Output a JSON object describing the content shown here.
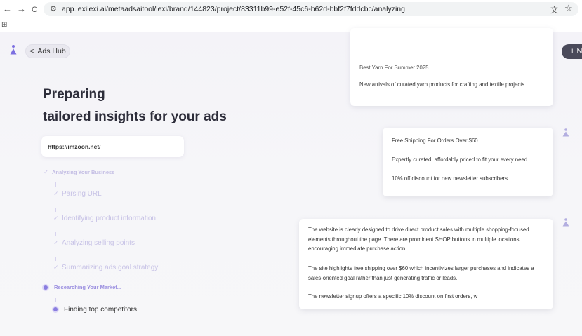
{
  "browser": {
    "back": "←",
    "forward": "→",
    "reload": "C",
    "url": "app.lexilexi.ai/metaadsaitool/lexi/brand/144823/project/83311b99-e52f-45c6-b62d-bbf2f7fddcbc/analyzing",
    "translate_icon": "translate-icon",
    "star": "☆",
    "apps": "⊞"
  },
  "header": {
    "back_label": "Ads Hub",
    "back_glyph": "<",
    "new_label": "+ N",
    "accent_color": "#7c6fe0"
  },
  "main": {
    "title_line1": "Preparing",
    "title_line2": "tailored insights for your ads",
    "url_value": "https://imzoon.net/"
  },
  "steps": [
    {
      "label": "Analyzing Your Business",
      "state": "done"
    },
    {
      "label": "Parsing URL",
      "state": "done"
    },
    {
      "label": "Identifying product information",
      "state": "done"
    },
    {
      "label": "Analyzing selling points",
      "state": "done"
    },
    {
      "label": "Summarizing ads goal strategy",
      "state": "done"
    },
    {
      "label": "Researching Your Market...",
      "state": "active"
    },
    {
      "label": "Finding top competitors",
      "state": "active"
    }
  ],
  "cards": {
    "card1": {
      "lines": [
        "Best Yarn For Summer 2025",
        "New arrivals of curated yarn products for crafting and textile projects"
      ]
    },
    "card2": {
      "lines": [
        "Free Shipping For Orders Over $60",
        "Expertly curated, affordably priced to fit your every need",
        "10% off discount for new newsletter subscribers"
      ]
    },
    "card3": {
      "paragraphs": [
        "The website is clearly designed to drive direct product sales with multiple shopping-focused elements throughout the page. There are prominent SHOP buttons in multiple locations encouraging immediate purchase action.",
        "The site highlights free shipping over $60 which incentivizes larger purchases and indicates a sales-oriented goal rather than just generating traffic or leads.",
        "The newsletter signup offers a specific 10% discount on first orders, w"
      ]
    }
  }
}
